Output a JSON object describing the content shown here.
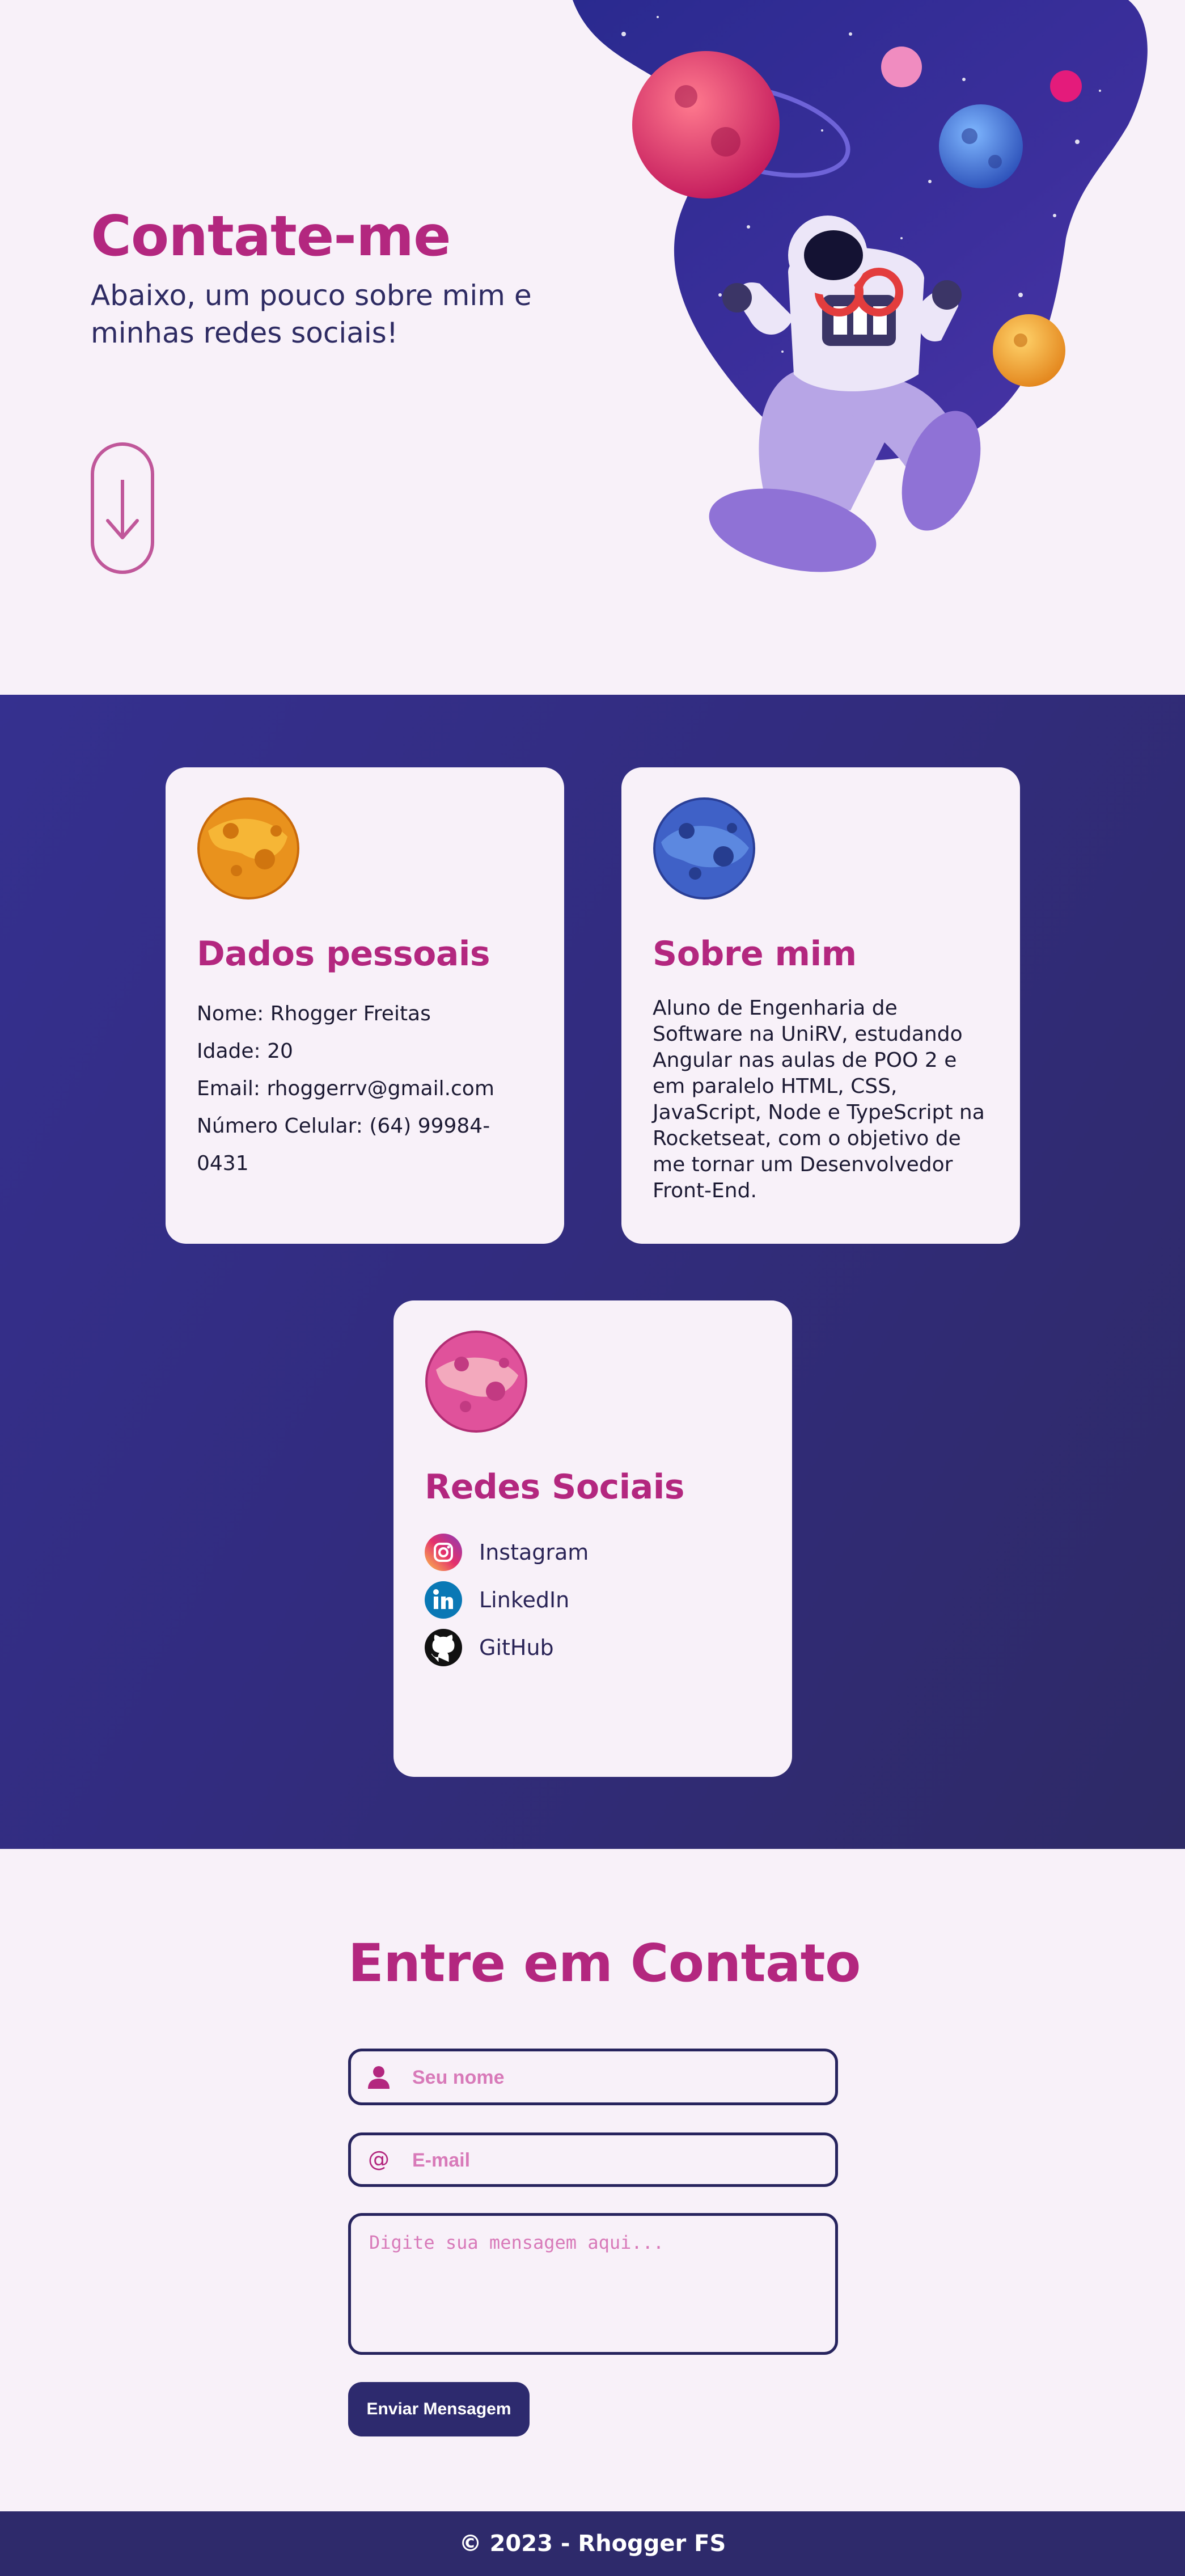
{
  "hero": {
    "title": "Contate-me",
    "subtitle": "Abaixo, um pouco sobre mim e minhas redes sociais!",
    "scroll_icon": "arrow-down-icon"
  },
  "cards": {
    "personal": {
      "title": "Dados pessoais",
      "icon": "orange-planet-icon",
      "lines": [
        "Nome: Rhogger Freitas",
        "Idade: 20",
        "Email: rhoggerrv@gmail.com",
        "Número Celular: (64) 99984-0431"
      ]
    },
    "about": {
      "title": "Sobre mim",
      "icon": "blue-planet-icon",
      "text": "Aluno de Engenharia de Software na UniRV, estudando Angular nas aulas de POO 2 e em paralelo HTML, CSS, JavaScript, Node e TypeScript na Rocketseat, com o objetivo de me tornar um Desenvolvedor Front-End."
    },
    "social": {
      "title": "Redes Sociais",
      "icon": "pink-planet-icon",
      "links": [
        {
          "label": "Instagram",
          "icon": "instagram-icon"
        },
        {
          "label": "LinkedIn",
          "icon": "linkedin-icon"
        },
        {
          "label": "GitHub",
          "icon": "github-icon"
        }
      ]
    }
  },
  "contact": {
    "title": "Entre em Contato",
    "name_placeholder": "Seu nome",
    "email_placeholder": "E-mail",
    "message_placeholder": "Digite sua mensagem aqui...",
    "send_label": "Enviar Mensagem"
  },
  "footer": {
    "text": "© 2023 - Rhogger FS"
  },
  "colors": {
    "accent": "#b3277f",
    "navy": "#2e2a6b",
    "background": "#f8f1f9"
  }
}
